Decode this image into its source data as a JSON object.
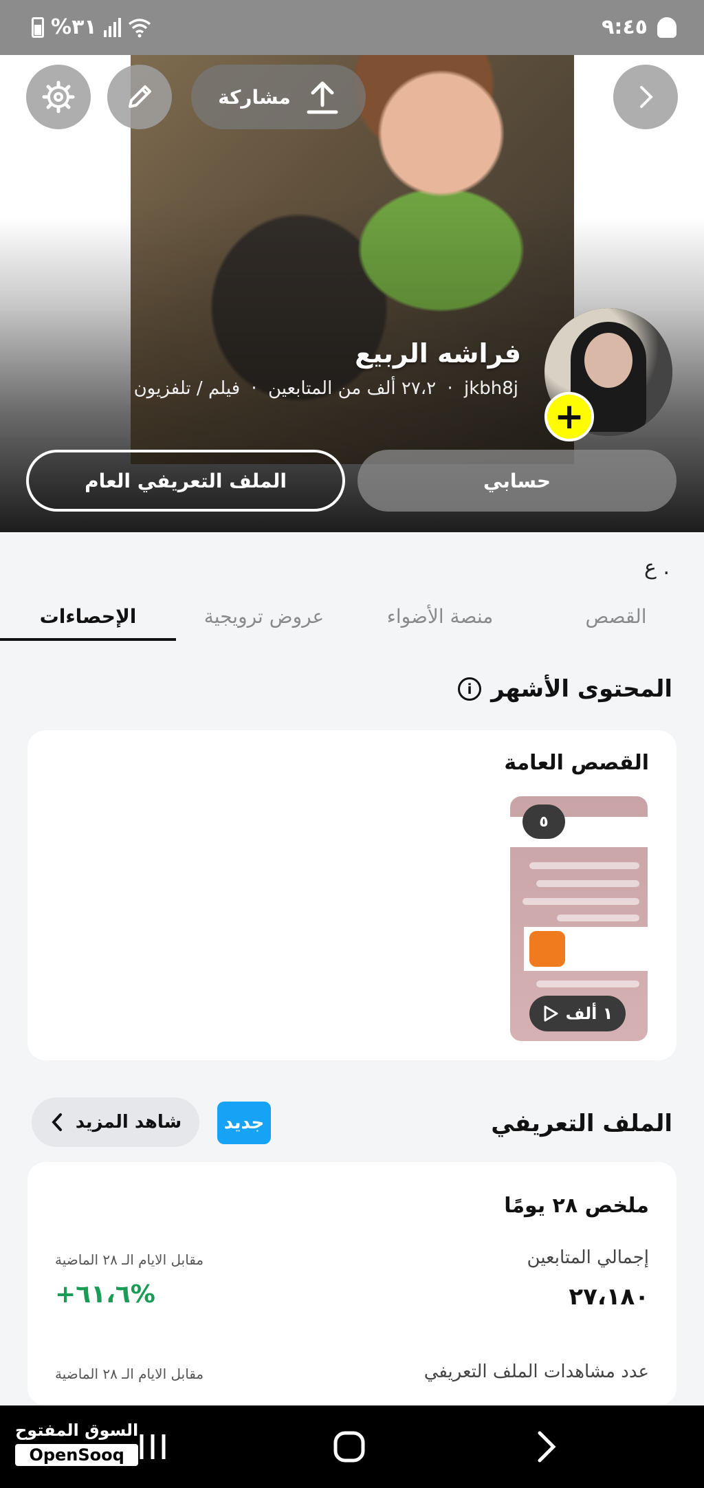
{
  "status_bar": {
    "time": "٩:٤٥",
    "battery": "%٣١"
  },
  "header": {
    "share_label": "مشاركة"
  },
  "profile": {
    "name": "فراشه الربيع",
    "username": "jkbh8j",
    "followers": "٢٧،٢ ألف من المتابعين",
    "category": "فيلم / تلفزيون",
    "separator": "·",
    "add_symbol": "+"
  },
  "buttons": {
    "account": "حسابي",
    "public_profile": "الملف التعريفي العام"
  },
  "misc": {
    "letter": "ع ."
  },
  "tabs": [
    {
      "label": "القصص",
      "active": false
    },
    {
      "label": "منصة الأضواء",
      "active": false
    },
    {
      "label": "عروض ترويجية",
      "active": false
    },
    {
      "label": "الإحصاءات",
      "active": true
    }
  ],
  "top_content": {
    "title": "المحتوى الأشهر",
    "card_title": "القصص العامة",
    "story_count": "٥",
    "story_views": "١ ألف"
  },
  "profile_section": {
    "title": "الملف التعريفي",
    "new_badge": "جديد",
    "see_more": "شاهد المزيد",
    "summary_title": "ملخص ٢٨ يومًا",
    "stats": [
      {
        "label": "إجمالي المتابعين",
        "value": "٢٧،١٨٠",
        "compare": "مقابل الايام الـ ٢٨ الماضية",
        "change": "+٦١،٦%"
      },
      {
        "label": "عدد مشاهدات الملف التعريفي",
        "value": "",
        "compare": "مقابل الايام الـ ٢٨ الماضية",
        "change": ""
      }
    ]
  },
  "watermark": {
    "arabic": "السوق المفتوح",
    "english": "OpenSooq"
  },
  "colors": {
    "accent_yellow": "#fffc00",
    "new_badge": "#16a3f5",
    "positive_change": "#1a9c56"
  }
}
